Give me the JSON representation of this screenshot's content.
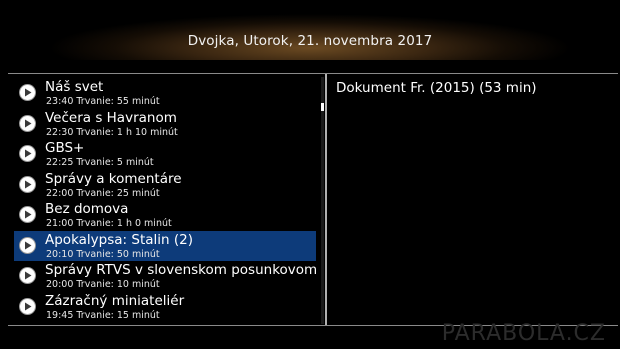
{
  "header": {
    "title": "Dvojka,  Utorok, 21. novembra 2017"
  },
  "list": {
    "items": [
      {
        "title": "Náš svet",
        "subtitle": "23:40 Trvanie: 55 minút",
        "icon": "play-icon",
        "selected": false
      },
      {
        "title": "Večera s Havranom",
        "subtitle": "22:30 Trvanie: 1 h 10 minút",
        "icon": "play-icon",
        "selected": false
      },
      {
        "title": "GBS+",
        "subtitle": "22:25 Trvanie: 5 minút",
        "icon": "play-icon",
        "selected": false
      },
      {
        "title": "Správy a komentáre",
        "subtitle": "22:00 Trvanie: 25 minút",
        "icon": "play-icon",
        "selected": false
      },
      {
        "title": "Bez domova",
        "subtitle": "21:00 Trvanie: 1 h 0 minút",
        "icon": "play-icon",
        "selected": false
      },
      {
        "title": "Apokalypsa: Stalin (2)",
        "subtitle": "20:10 Trvanie: 50 minút",
        "icon": "play-icon",
        "selected": true
      },
      {
        "title": "Správy RTVS v slovenskom posunkovom j",
        "subtitle": "20:00 Trvanie: 10 minút",
        "icon": "play-icon",
        "selected": false
      },
      {
        "title": "Zázračný miniateliér",
        "subtitle": "19:45 Trvanie: 15 minút",
        "icon": "play-icon",
        "selected": false
      }
    ]
  },
  "detail": {
    "text": "Dokument Fr. (2015) (53 min)"
  },
  "watermark": {
    "text": "PARABOLA.CZ"
  },
  "colors": {
    "background": "#000000",
    "selection": "#0d3b7a",
    "header_glow": "#6b4a22",
    "text": "#ffffff"
  }
}
